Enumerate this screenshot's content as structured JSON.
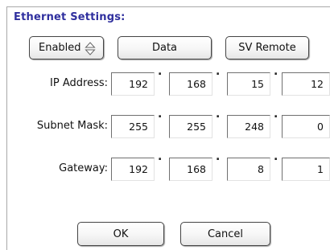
{
  "section_title": "Ethernet Settings:",
  "mode_select": {
    "value": "Enabled"
  },
  "buttons": {
    "data": "Data",
    "sv_remote": "SV Remote",
    "ok": "OK",
    "cancel": "Cancel"
  },
  "ip_address": {
    "label": "IP Address:",
    "octets": [
      "192",
      "168",
      "15",
      "12"
    ]
  },
  "subnet_mask": {
    "label": "Subnet Mask:",
    "octets": [
      "255",
      "255",
      "248",
      "0"
    ]
  },
  "gateway": {
    "label": "Gateway:",
    "octets": [
      "192",
      "168",
      "8",
      "1"
    ]
  },
  "octet_separator": ".",
  "colors": {
    "title": "#2f2f9e",
    "border": "#a9a9a9",
    "button_border": "#444444"
  },
  "icons": {
    "mode_spinner": "up-down-arrows-icon"
  }
}
